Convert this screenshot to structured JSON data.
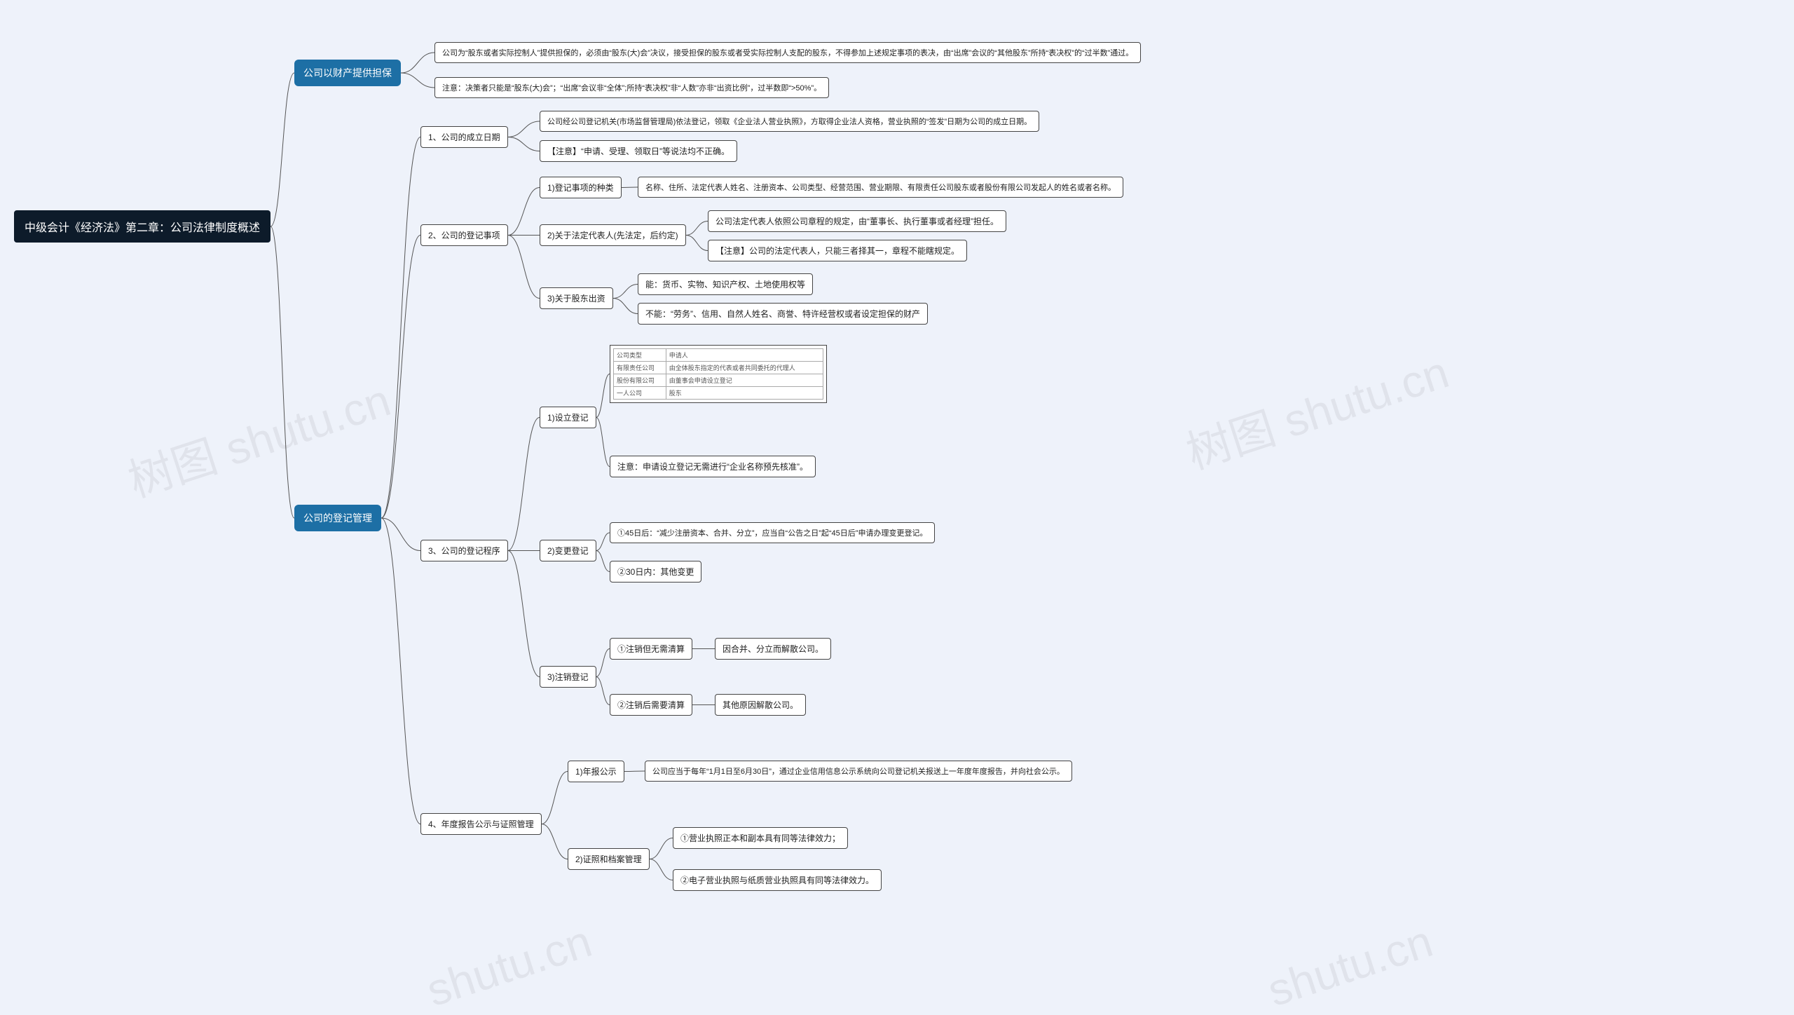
{
  "root": "中级会计《经济法》第二章：公司法律制度概述",
  "b1": {
    "title": "公司以财产提供担保",
    "n1": "公司为“股东或者实际控制人”提供担保的，必须由“股东(大)会”决议，接受担保的股东或者受实际控制人支配的股东，不得参加上述规定事项的表决，由“出席”会议的“其他股东”所持“表决权”的“过半数”通过。",
    "n2": "注意：决策者只能是“股东(大)会”；“出席”会议非“全体”;所持“表决权”非“人数”亦非“出资比例”，过半数即“>50%”。"
  },
  "b2": {
    "title": "公司的登记管理",
    "s1": {
      "title": "1、公司的成立日期",
      "n1": "公司经公司登记机关(市场监督管理局)依法登记，领取《企业法人营业执照》，方取得企业法人资格，营业执照的“签发”日期为公司的成立日期。",
      "n2": "【注意】“申请、受理、领取日”等说法均不正确。"
    },
    "s2": {
      "title": "2、公司的登记事项",
      "a": {
        "title": "1)登记事项的种类",
        "n1": "名称、住所、法定代表人姓名、注册资本、公司类型、经营范围、营业期限、有限责任公司股东或者股份有限公司发起人的姓名或者名称。"
      },
      "b": {
        "title": "2)关于法定代表人(先法定，后约定)",
        "n1": "公司法定代表人依照公司章程的规定，由“董事长、执行董事或者经理”担任。",
        "n2": "【注意】公司的法定代表人，只能三者择其一，章程不能瞎规定。"
      },
      "c": {
        "title": "3)关于股东出资",
        "n1": "能：货币、实物、知识产权、土地使用权等",
        "n2": "不能：“劳务”、信用、自然人姓名、商誉、特许经营权或者设定担保的财产"
      }
    },
    "s3": {
      "title": "3、公司的登记程序",
      "a": {
        "title": "1)设立登记",
        "tbl": {
          "r1c1": "公司类型",
          "r1c2": "申请人",
          "r2c1": "有限责任公司",
          "r2c2": "由全体股东指定的代表或者共同委托的代理人",
          "r3c1": "股份有限公司",
          "r3c2": "由董事会申请设立登记",
          "r4c1": "一人公司",
          "r4c2": "股东"
        },
        "n1": "注意：申请设立登记无需进行“企业名称预先核准”。"
      },
      "b": {
        "title": "2)变更登记",
        "n1": "①45日后：“减少注册资本、合并、分立”，应当自“公告之日”起“45日后”申请办理变更登记。",
        "n2": "②30日内：其他变更"
      },
      "c": {
        "title": "3)注销登记",
        "n1": "①注销但无需清算",
        "n1d": "因合并、分立而解散公司。",
        "n2": "②注销后需要清算",
        "n2d": "其他原因解散公司。"
      }
    },
    "s4": {
      "title": "4、年度报告公示与证照管理",
      "a": {
        "title": "1)年报公示",
        "n1": "公司应当于每年“1月1日至6月30日”，通过企业信用信息公示系统向公司登记机关报送上一年度年度报告，并向社会公示。"
      },
      "b": {
        "title": "2)证照和档案管理",
        "n1": "①营业执照正本和副本具有同等法律效力；",
        "n2": "②电子营业执照与纸质营业执照具有同等法律效力。"
      }
    }
  },
  "wm": "树图 shutu.cn",
  "wm2": "shutu.cn"
}
